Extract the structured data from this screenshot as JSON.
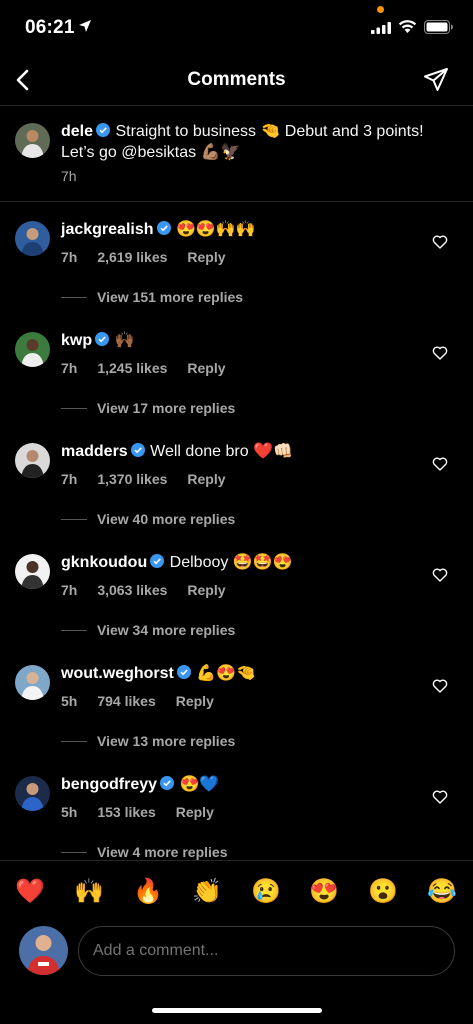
{
  "status_bar": {
    "time": "06:21"
  },
  "header": {
    "title": "Comments"
  },
  "caption": {
    "username": "dele",
    "text": "Straight to business 🤏 Debut and 3 points! Let’s go @besiktas 💪🏽🦅",
    "time": "7h"
  },
  "comments": [
    {
      "username": "jackgrealish",
      "text": "😍😍🙌🙌",
      "time": "7h",
      "likes": "2,619 likes",
      "reply": "Reply",
      "view_replies": "View 151 more replies"
    },
    {
      "username": "kwp",
      "text": "🙌🏾",
      "time": "7h",
      "likes": "1,245 likes",
      "reply": "Reply",
      "view_replies": "View 17 more replies"
    },
    {
      "username": "madders",
      "text": "Well done bro ❤️👊🏻",
      "time": "7h",
      "likes": "1,370 likes",
      "reply": "Reply",
      "view_replies": "View 40 more replies"
    },
    {
      "username": "gknkoudou",
      "text": "Delbooy 🤩🤩😍",
      "time": "7h",
      "likes": "3,063 likes",
      "reply": "Reply",
      "view_replies": "View 34 more replies"
    },
    {
      "username": "wout.weghorst",
      "text": "💪😍🤏",
      "time": "5h",
      "likes": "794 likes",
      "reply": "Reply",
      "view_replies": "View 13 more replies"
    },
    {
      "username": "bengodfreyy",
      "text": "😍💙",
      "time": "5h",
      "likes": "153 likes",
      "reply": "Reply",
      "view_replies": "View 4 more replies"
    }
  ],
  "emoji_bar": [
    "❤️",
    "🙌",
    "🔥",
    "👏",
    "😢",
    "😍",
    "😮",
    "😂"
  ],
  "input": {
    "placeholder": "Add a comment..."
  },
  "colors": {
    "background": "#000000",
    "secondary_text": "#a8a8a8",
    "verified": "#3897f0",
    "divider": "#262626"
  }
}
